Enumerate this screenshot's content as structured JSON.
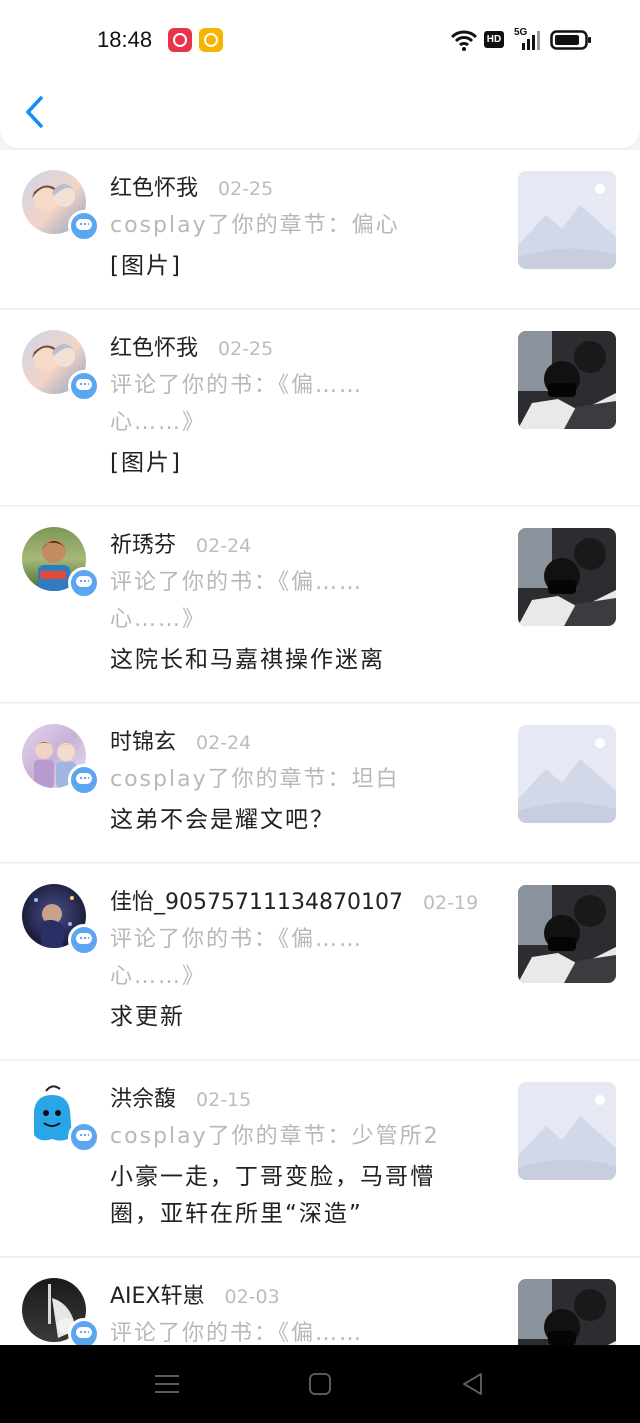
{
  "status_bar": {
    "time": "18:48",
    "hd": "HD",
    "network": "5G"
  },
  "header": {
    "back_icon": "chevron-left-icon"
  },
  "colors": {
    "accent": "#1a8bf0",
    "badge": "#5aa6f0",
    "name": "#222222",
    "muted": "#b8b8b8"
  },
  "notifications": [
    {
      "user": "红色怀我",
      "date": "02-25",
      "action": "cosplay了你的章节：偏心",
      "content": "[图片]",
      "thumb": "placeholder"
    },
    {
      "user": "红色怀我",
      "date": "02-25",
      "action": "评论了你的书：《偏……心……》",
      "content": "[图片]",
      "thumb": "photo"
    },
    {
      "user": "祈琇芬",
      "date": "02-24",
      "action": "评论了你的书：《偏……心……》",
      "content": "这院长和马嘉祺操作迷离",
      "thumb": "photo"
    },
    {
      "user": "时锦玄",
      "date": "02-24",
      "action": "cosplay了你的章节：坦白",
      "content": "这弟不会是耀文吧？",
      "thumb": "placeholder"
    },
    {
      "user": "佳怡_9057571113487010​7",
      "date": "02-19",
      "action": "评论了你的书：《偏……心……》",
      "content": "求更新",
      "thumb": "photo"
    },
    {
      "user": "洪佘馥",
      "date": "02-15",
      "action": "cosplay了你的章节：少管所2",
      "content": "小豪一走，丁哥变脸，马哥懵圈，亚轩在所里“深造”",
      "thumb": "placeholder"
    },
    {
      "user": "AIEX轩崽",
      "date": "02-03",
      "action": "评论了你的书：《偏……",
      "content": "",
      "thumb": "photo"
    }
  ],
  "nav": {
    "menu_icon": "menu-icon",
    "home_icon": "home-icon",
    "back_icon": "back-triangle-icon"
  }
}
